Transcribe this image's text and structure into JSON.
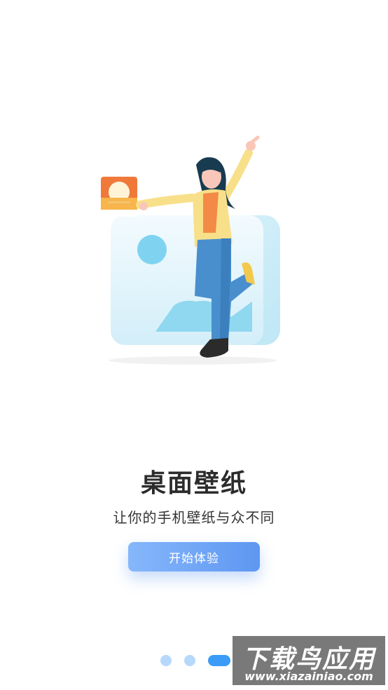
{
  "main": {
    "title": "桌面壁纸",
    "subtitle": "让你的手机壁纸与众不同",
    "start_button": "开始体验"
  },
  "pager": {
    "count": 3,
    "active_index": 2
  },
  "watermark": {
    "title": "下载鸟应用",
    "url": "www.xiazainiao.com"
  },
  "colors": {
    "accent": "#3a9cf6",
    "button_start": "#86b7fb",
    "button_end": "#5e97f2"
  },
  "icons": [
    "sun-photo-icon",
    "wallpaper-illustration"
  ]
}
